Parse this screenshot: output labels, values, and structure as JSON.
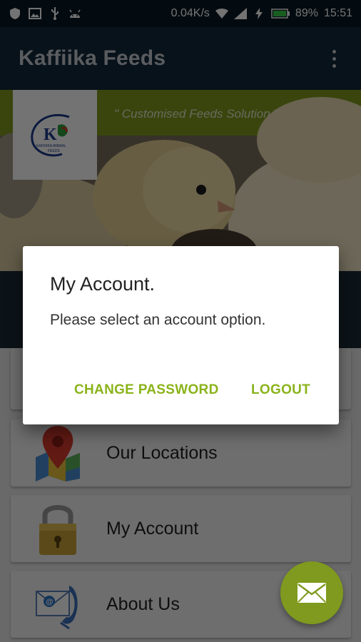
{
  "status_bar": {
    "network_speed": "0.04K/s",
    "battery": "89%",
    "time": "15:51"
  },
  "app_bar": {
    "title": "Kaffiika Feeds"
  },
  "banner": {
    "tagline": "\" Customised Feeds Solution \"",
    "logo_text": "KAFFIIKA ANIMAL FEEDS"
  },
  "menu": {
    "items": [
      {
        "label": "",
        "icon": "hidden-item-icon"
      },
      {
        "label": "Our Locations",
        "icon": "map-pin-icon"
      },
      {
        "label": "My Account",
        "icon": "padlock-icon"
      },
      {
        "label": "About Us",
        "icon": "contact-icon"
      }
    ]
  },
  "dialog": {
    "title": "My Account.",
    "message": "Please select an account option.",
    "change_password_label": "CHANGE PASSWORD",
    "logout_label": "LOGOUT"
  },
  "fab": {
    "icon": "mail-icon"
  },
  "colors": {
    "accent": "#8ab31a",
    "app_bar": "#12293a",
    "status_bar": "#0b1a25"
  }
}
